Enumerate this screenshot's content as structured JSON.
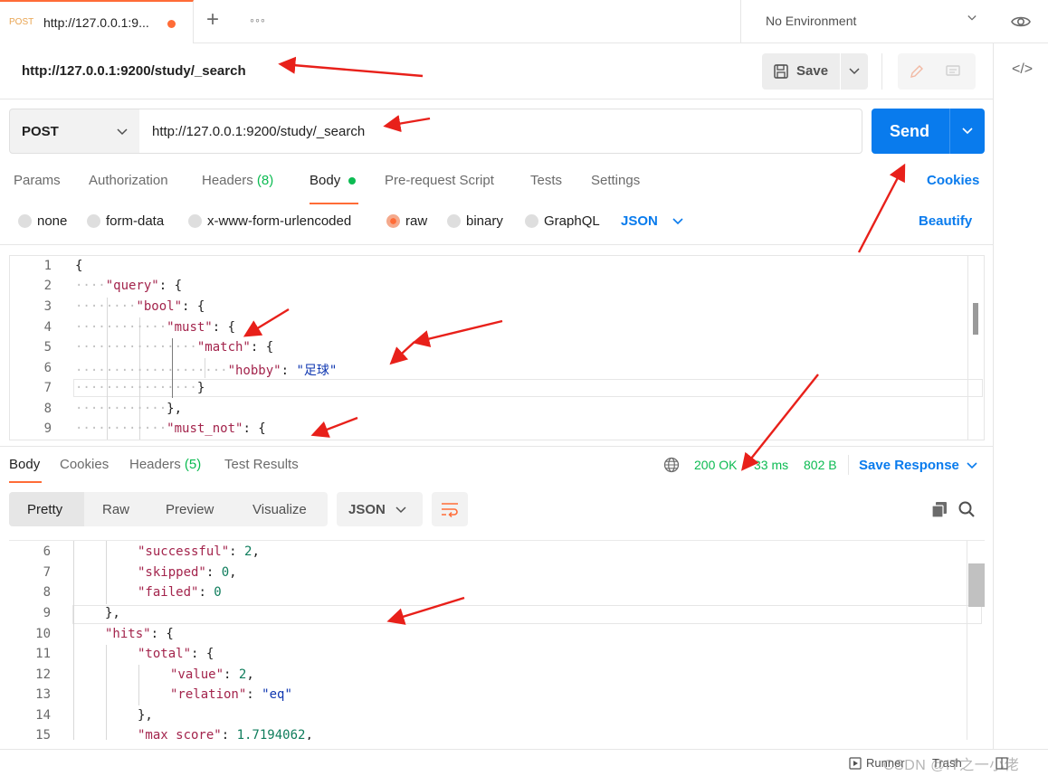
{
  "tab": {
    "method": "POST",
    "title": "http://127.0.0.1:9..."
  },
  "environment": {
    "label": "No Environment"
  },
  "request": {
    "title": "http://127.0.0.1:9200/study/_search",
    "save_label": "Save",
    "method": "POST",
    "url": "http://127.0.0.1:9200/study/_search",
    "send_label": "Send",
    "tabs": {
      "params": "Params",
      "authorization": "Authorization",
      "headers": "Headers",
      "headers_count": "(8)",
      "body": "Body",
      "prerequest": "Pre-request Script",
      "tests": "Tests",
      "settings": "Settings"
    },
    "cookies_label": "Cookies",
    "body_types": {
      "none": "none",
      "form_data": "form-data",
      "urlencoded": "x-www-form-urlencoded",
      "raw": "raw",
      "binary": "binary",
      "graphql": "GraphQL"
    },
    "selected_body_type": "raw",
    "raw_format": "JSON",
    "beautify_label": "Beautify",
    "code_lines": [
      {
        "n": "1"
      },
      {
        "n": "2"
      },
      {
        "n": "3"
      },
      {
        "n": "4"
      },
      {
        "n": "5"
      },
      {
        "n": "6"
      },
      {
        "n": "7"
      },
      {
        "n": "8"
      },
      {
        "n": "9"
      }
    ],
    "code": {
      "l1": "{",
      "l2_key": "\"query\"",
      "l2_rest": ": {",
      "l3_key": "\"bool\"",
      "l3_rest": ": {",
      "l4_key": "\"must\"",
      "l4_rest": ": {",
      "l5_key": "\"match\"",
      "l5_rest": ": {",
      "l6_key": "\"hobby\"",
      "l6_colon": ": ",
      "l6_val": "\"足球\"",
      "l7": "}",
      "l8": "},",
      "l9_key": "\"must_not\"",
      "l9_rest": ": {"
    }
  },
  "response": {
    "tabs": {
      "body": "Body",
      "cookies": "Cookies",
      "headers": "Headers",
      "headers_count": "(5)",
      "test_results": "Test Results"
    },
    "status": "200 OK",
    "time": "33 ms",
    "size": "802 B",
    "save_response_label": "Save Response",
    "views": {
      "pretty": "Pretty",
      "raw": "Raw",
      "preview": "Preview",
      "visualize": "Visualize"
    },
    "format": "JSON",
    "line_numbers": [
      "6",
      "7",
      "8",
      "9",
      "10",
      "11",
      "12",
      "13",
      "14",
      "15"
    ],
    "code": {
      "l6_key": "\"successful\"",
      "l6_colon": ": ",
      "l6_val": "2",
      "l6_tail": ",",
      "l7_key": "\"skipped\"",
      "l7_colon": ": ",
      "l7_val": "0",
      "l7_tail": ",",
      "l8_key": "\"failed\"",
      "l8_colon": ": ",
      "l8_val": "0",
      "l9": "},",
      "l10_key": "\"hits\"",
      "l10_rest": ": {",
      "l11_key": "\"total\"",
      "l11_rest": ": {",
      "l12_key": "\"value\"",
      "l12_colon": ": ",
      "l12_val": "2",
      "l12_tail": ",",
      "l13_key": "\"relation\"",
      "l13_colon": ": ",
      "l13_val": "\"eq\"",
      "l14": "},",
      "l15_key": "\"max_score\"",
      "l15_colon": ": ",
      "l15_val": "1.7194062",
      "l15_tail": ","
    }
  },
  "statusbar": {
    "runner": "Runner",
    "trash": "Trash"
  },
  "watermark": "CSDN @IT之一小佬",
  "colors": {
    "accent": "#ff6c37",
    "primary": "#097bed",
    "success": "#0cbb52",
    "annotation_arrow": "#e8201a"
  }
}
